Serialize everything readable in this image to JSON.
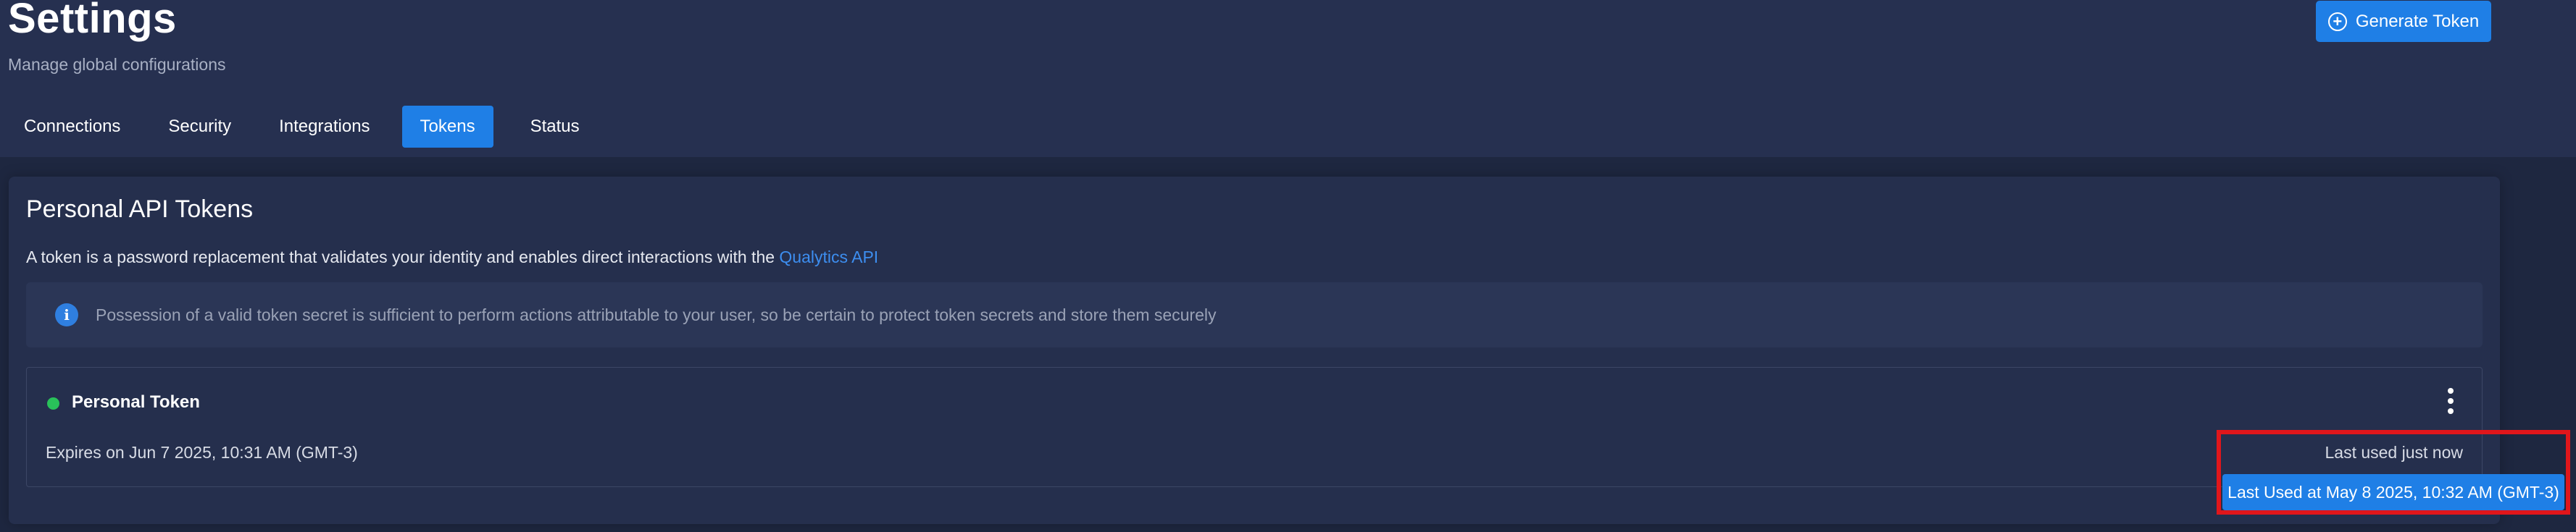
{
  "header": {
    "title": "Settings",
    "subtitle": "Manage global configurations",
    "generate_button": "Generate Token"
  },
  "tabs": [
    {
      "label": "Connections",
      "active": false
    },
    {
      "label": "Security",
      "active": false
    },
    {
      "label": "Integrations",
      "active": false
    },
    {
      "label": "Tokens",
      "active": true
    },
    {
      "label": "Status",
      "active": false
    }
  ],
  "tokens_section": {
    "title": "Personal API Tokens",
    "description_prefix": "A token is a password replacement that validates your identity and enables direct interactions with the ",
    "description_link": "Qualytics API",
    "info_icon": "i",
    "info_text": "Possession of a valid token secret is sufficient to perform actions attributable to your user, so be certain to protect token secrets and store them securely"
  },
  "token_item": {
    "name": "Personal Token",
    "status_color": "#29c25a",
    "expires": "Expires on Jun 7 2025, 10:31 AM (GMT-3)",
    "last_used": "Last used just now",
    "tooltip": "Last Used at May 8 2025, 10:32 AM (GMT-3)"
  },
  "colors": {
    "accent": "#1f7fe6",
    "highlight": "#e0161b"
  }
}
